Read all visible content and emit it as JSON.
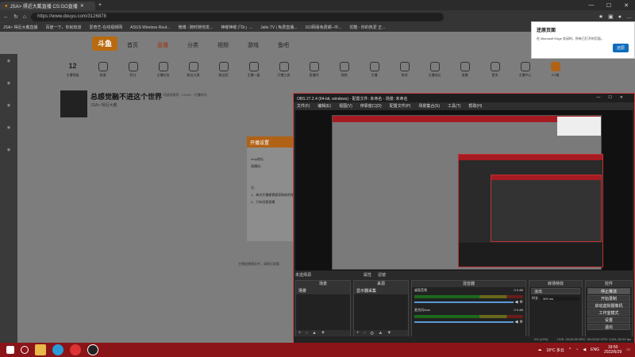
{
  "browser": {
    "tab_title": "JSA> 得近大戴直播 CS:GO直播",
    "url": "https://www.douyu.com/3126878",
    "favorites": [
      "JSA> 得近大戴直播",
      "百度一下，你就知道",
      "爱奇艺-在线视频网",
      "ASUS Wireless Rout...",
      "微博 - 随时随地发...",
      "神曜神曜 (「Dr」...",
      "Jalie.TV | 免费直播...",
      "163网易免费邮--中...",
      "优酷 - 你的热爱 正..."
    ]
  },
  "douyu": {
    "logo": "斗鱼",
    "nav": [
      "首页",
      "直播",
      "分类",
      "视频",
      "游戏",
      "鱼吧"
    ],
    "level_num": "12",
    "icons": [
      "主播等级",
      "鱼塘",
      "积分",
      "主播任务",
      "粉丝大屏",
      "粉丝团",
      "主播一级",
      "开播工具",
      "直播间",
      "视频",
      "主播",
      "鱼吧",
      "主播成长",
      "直播",
      "更多",
      "主播中心",
      "PC端"
    ],
    "room_title": "总感觉融不进这个世界",
    "room_sub": "房间 · 同游戏推荐 · CSGO · 开播时间",
    "streamer": "JSA> 得近大戴",
    "modal_title": "开播设置",
    "modal_rtmp": "rtmp地址:",
    "modal_code": "直播码:",
    "modal_note": "注:",
    "modal_note1": "1、每次开播都需要获取新的推流码",
    "modal_note2": "2、只有切换直播",
    "page_hint": "主播直播预告中，请稍后观看"
  },
  "popup": {
    "title": "还原页面",
    "text": "在 Microsoft Edge 关闭时，你有已打开的页面。",
    "button": "还原"
  },
  "obs": {
    "title": "OBS 27.2.4 (64-bit, windows) - 配置文件: 未命名 - 场景: 未命名",
    "menu": [
      "文件(F)",
      "编辑(E)",
      "视图(V)",
      "停靠窗口(D)",
      "配置文件(P)",
      "场景集合(S)",
      "工具(T)",
      "帮助(H)"
    ],
    "no_scene": "未选择源",
    "properties": "属性",
    "filters": "滤镜",
    "docks": {
      "scenes": {
        "title": "场景",
        "items": [
          "场景"
        ]
      },
      "sources": {
        "title": "来源",
        "items": [
          "显示器采集"
        ]
      },
      "mixer": {
        "title": "混音器",
        "ch1": "桌面音频",
        "ch1_db": "0.0 dB",
        "ch2": "麦克风/Aux",
        "ch2_db": "0.0 dB"
      },
      "transitions": {
        "title": "转场特效",
        "type": "淡出",
        "duration_label": "时长",
        "duration": "300 ms"
      },
      "controls": {
        "title": "控件",
        "buttons": [
          "停止推流",
          "开始录制",
          "启动虚拟摄像机",
          "工作室模式",
          "设置",
          "退出"
        ]
      }
    },
    "status": "LIVE: 00:00:00   REC: 00:00:00   CPU: 3.6%, 60.00 fps",
    "dropped": "0% (12%)"
  },
  "taskbar": {
    "weather": "18°C 多云",
    "lang": "ENG",
    "time": "19:50",
    "date": "2022/6/29"
  },
  "colors": {
    "accent": "#a61b22",
    "douyu_orange": "#b06217",
    "edge_blue": "#0f6cbd"
  }
}
